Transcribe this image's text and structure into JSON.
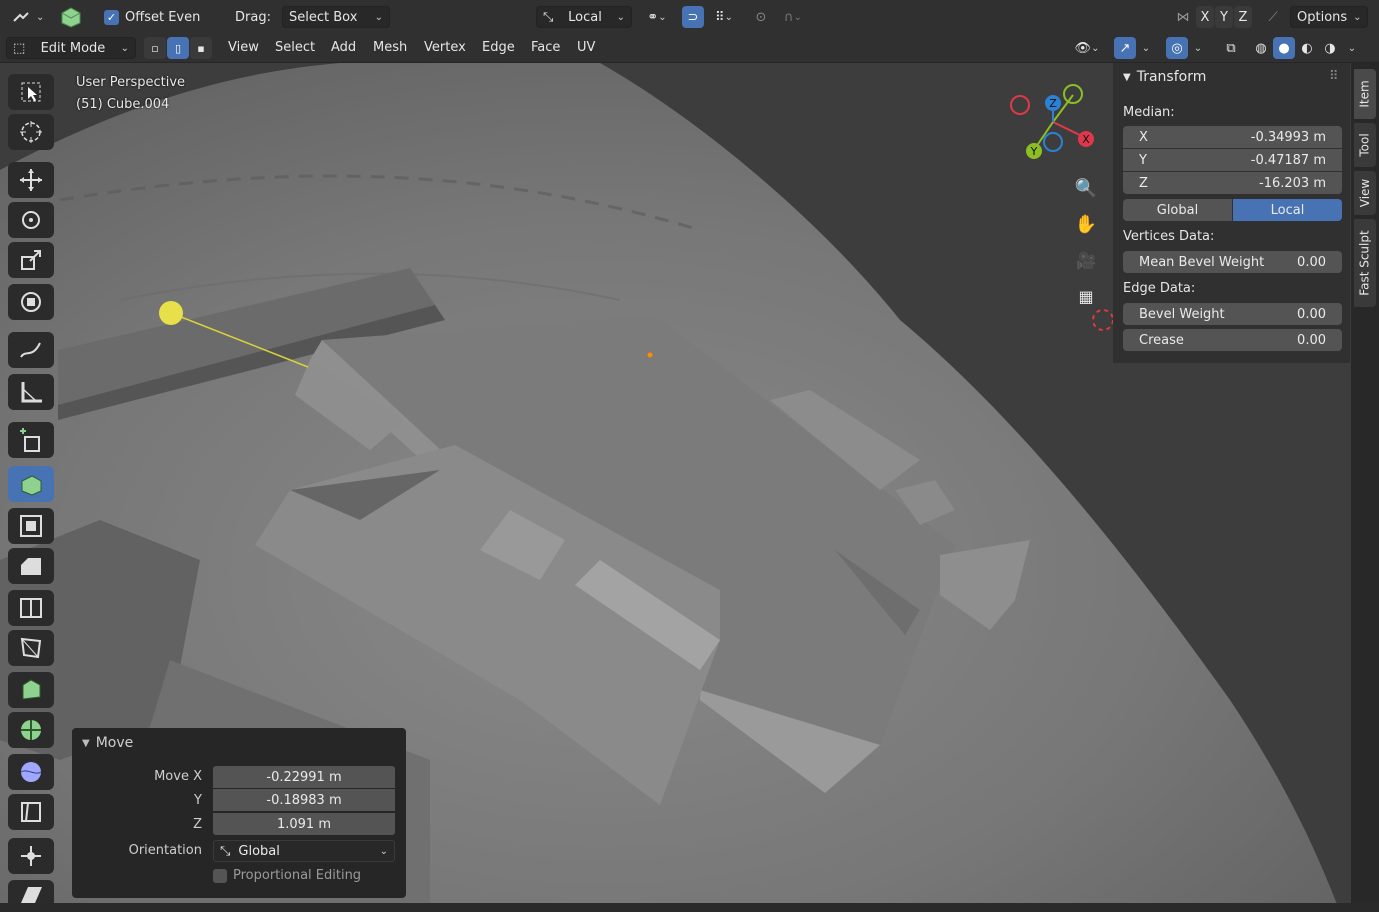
{
  "header": {
    "offset_even_label": "Offset Even",
    "drag_label": "Drag:",
    "drag_value": "Select Box",
    "orientation_value": "Local",
    "axis_x": "X",
    "axis_y": "Y",
    "axis_z": "Z",
    "options_label": "Options"
  },
  "header2": {
    "mode_value": "Edit Mode",
    "menus": [
      "View",
      "Select",
      "Add",
      "Mesh",
      "Vertex",
      "Edge",
      "Face",
      "UV"
    ]
  },
  "viewport": {
    "perspective_label": "User Perspective",
    "object_label": "(51) Cube.004"
  },
  "gizmo": {
    "z_label": "Z",
    "y_label": "Y",
    "x_label": "X"
  },
  "transform_panel": {
    "title": "Transform",
    "median_label": "Median:",
    "x_label": "X",
    "x_value": "-0.34993 m",
    "y_label": "Y",
    "y_value": "-0.47187 m",
    "z_label": "Z",
    "z_value": "-16.203 m",
    "global_label": "Global",
    "local_label": "Local",
    "vertices_data_label": "Vertices Data:",
    "mean_bevel_weight_label": "Mean Bevel Weight",
    "mean_bevel_weight_value": "0.00",
    "edge_data_label": "Edge Data:",
    "bevel_weight_label": "Bevel Weight",
    "bevel_weight_value": "0.00",
    "crease_label": "Crease",
    "crease_value": "0.00"
  },
  "side_tabs": [
    "Item",
    "Tool",
    "View",
    "Fast Sculpt"
  ],
  "move_panel": {
    "title": "Move",
    "move_x_label": "Move X",
    "move_x_value": "-0.22991 m",
    "y_label": "Y",
    "y_value": "-0.18983 m",
    "z_label": "Z",
    "z_value": "1.091 m",
    "orientation_label": "Orientation",
    "orientation_value": "Global",
    "proportional_label": "Proportional Editing"
  },
  "colors": {
    "accent": "#4772b3",
    "axis_x": "#e0384a",
    "axis_y": "#8bbf23",
    "axis_z": "#2d81d4"
  }
}
